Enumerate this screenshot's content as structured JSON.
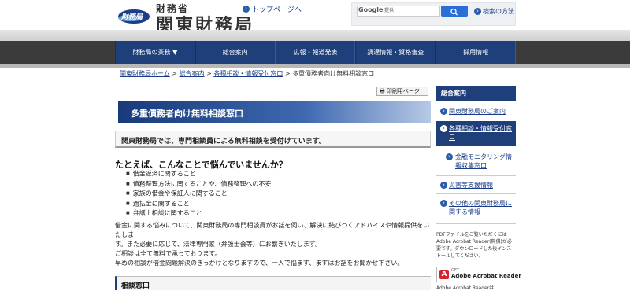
{
  "header": {
    "org_small": "財務省",
    "org_big": "関東財務局",
    "top_link": "トップページへ",
    "search_placeholder": "提供",
    "google_label": "Google",
    "search_help": "検索の方法"
  },
  "nav": {
    "items": [
      "財務局の業務 ▼",
      "総合案内",
      "広報・報道発表",
      "調達情報・資格審査",
      "採用情報"
    ]
  },
  "breadcrumb": {
    "home": "関東財務局ホーム",
    "level1": "総合案内",
    "level2": "各種相談・情報受付窓口",
    "current": "多重債務者向け無料相談窓口",
    "sep": " > "
  },
  "main": {
    "print_label": "印刷用ページ",
    "page_title": "多重債務者向け無料相談窓口",
    "lead": "関東財務局では、専門相談員による無料相談を受付けています。",
    "question_heading": "たとえば、こんなことで悩んでいませんか？",
    "concerns": [
      "借金返済に関すること",
      "債務整理方法に関することや、債務整理への不安",
      "家族の借金や保証人に関すること",
      "過払金に関すること",
      "弁護士相談に関すること"
    ],
    "para1_line1": "借金に関する悩みについて、関東財務局の専門相談員がお話を伺い、解決に結びつくアドバイスや情報提供をいたしま",
    "para1_line2": "す。また必要に応じて、法律専門家（弁護士会等）にお繋ぎいたします。",
    "para2_line1": "ご相談は全て無料で承っております。",
    "para2_line2": "早めの相談が借金問題解決のきっかけとなりますので、一人で悩まず、まずはお話をお聞かせ下さい。",
    "section_title": "相談窓口"
  },
  "sidebar": {
    "heading": "総合案内",
    "items": [
      "関東財務局のご案内",
      "各種相談・情報受付窓口",
      "金融モニタリング情報収集窓口",
      "災害等支援情報",
      "その他の関東財務局に関する情報"
    ],
    "pdf_note": "PDFファイルをご覧いただくにはAdobe Acrobat Reader(無償)が必要です。ダウンロードした後インストールしてください。",
    "acrobat_get": "GET",
    "acrobat_label": "Adobe Acrobat Reader",
    "pdf_note2": "Adobe Acrobat Readerは"
  }
}
